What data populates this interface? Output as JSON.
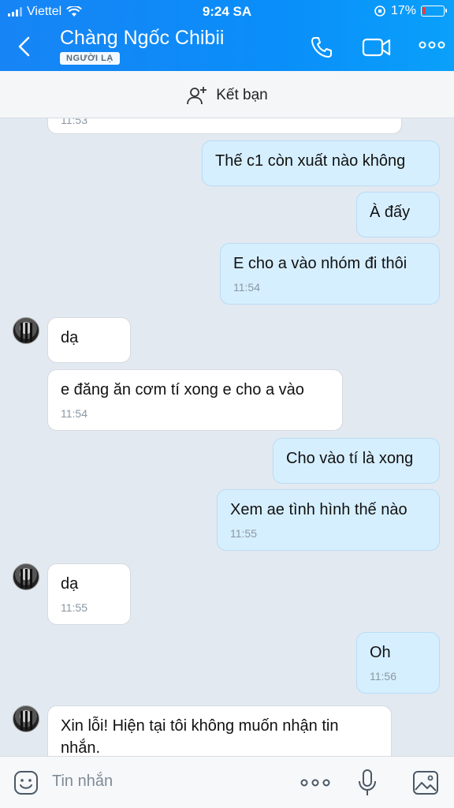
{
  "status_bar": {
    "carrier": "Viettel",
    "time": "9:24 SA",
    "battery": "17%",
    "battery_level": 0.17
  },
  "header": {
    "title": "Chàng Ngốc Chibii",
    "badge": "NGƯỜI LẠ"
  },
  "add_friend": {
    "label": "Kết bạn"
  },
  "messages": [
    {
      "dir": "in",
      "text": "",
      "time": "11:53"
    },
    {
      "dir": "out",
      "text": "Thế c1 còn xuất nào không",
      "time": ""
    },
    {
      "dir": "out",
      "text": "À đấy",
      "time": ""
    },
    {
      "dir": "out",
      "text": "E cho a vào nhóm đi thôi",
      "time": "11:54"
    },
    {
      "dir": "in",
      "text": "dạ",
      "time": ""
    },
    {
      "dir": "in",
      "text": "e đăng ăn cơm tí xong e cho a vào",
      "time": "11:54"
    },
    {
      "dir": "out",
      "text": "Cho vào tí là xong",
      "time": ""
    },
    {
      "dir": "out",
      "text": "Xem ae tình hình thế nào",
      "time": "11:55"
    },
    {
      "dir": "in",
      "text": "dạ",
      "time": "11:55"
    },
    {
      "dir": "out",
      "text": "Oh",
      "time": "11:56"
    },
    {
      "dir": "in",
      "text_line1": "Xin lỗi! Hiện tại tôi không muốn nhận tin",
      "text_line2": "nhắn.",
      "time": ""
    }
  ],
  "composer": {
    "placeholder": "Tin nhắn"
  },
  "icons": {
    "back": "chevron-left-icon",
    "call": "phone-icon",
    "video": "video-camera-icon",
    "more": "more-icon",
    "add_friend": "add-user-icon",
    "sticker": "sticker-icon",
    "composer_more": "more-icon",
    "mic": "microphone-icon",
    "image": "image-icon"
  },
  "colors": {
    "accent": "#0a8ef9",
    "outgoing_bubble": "#d6efff",
    "incoming_bubble": "#ffffff",
    "chat_background": "#e2e9f1"
  }
}
